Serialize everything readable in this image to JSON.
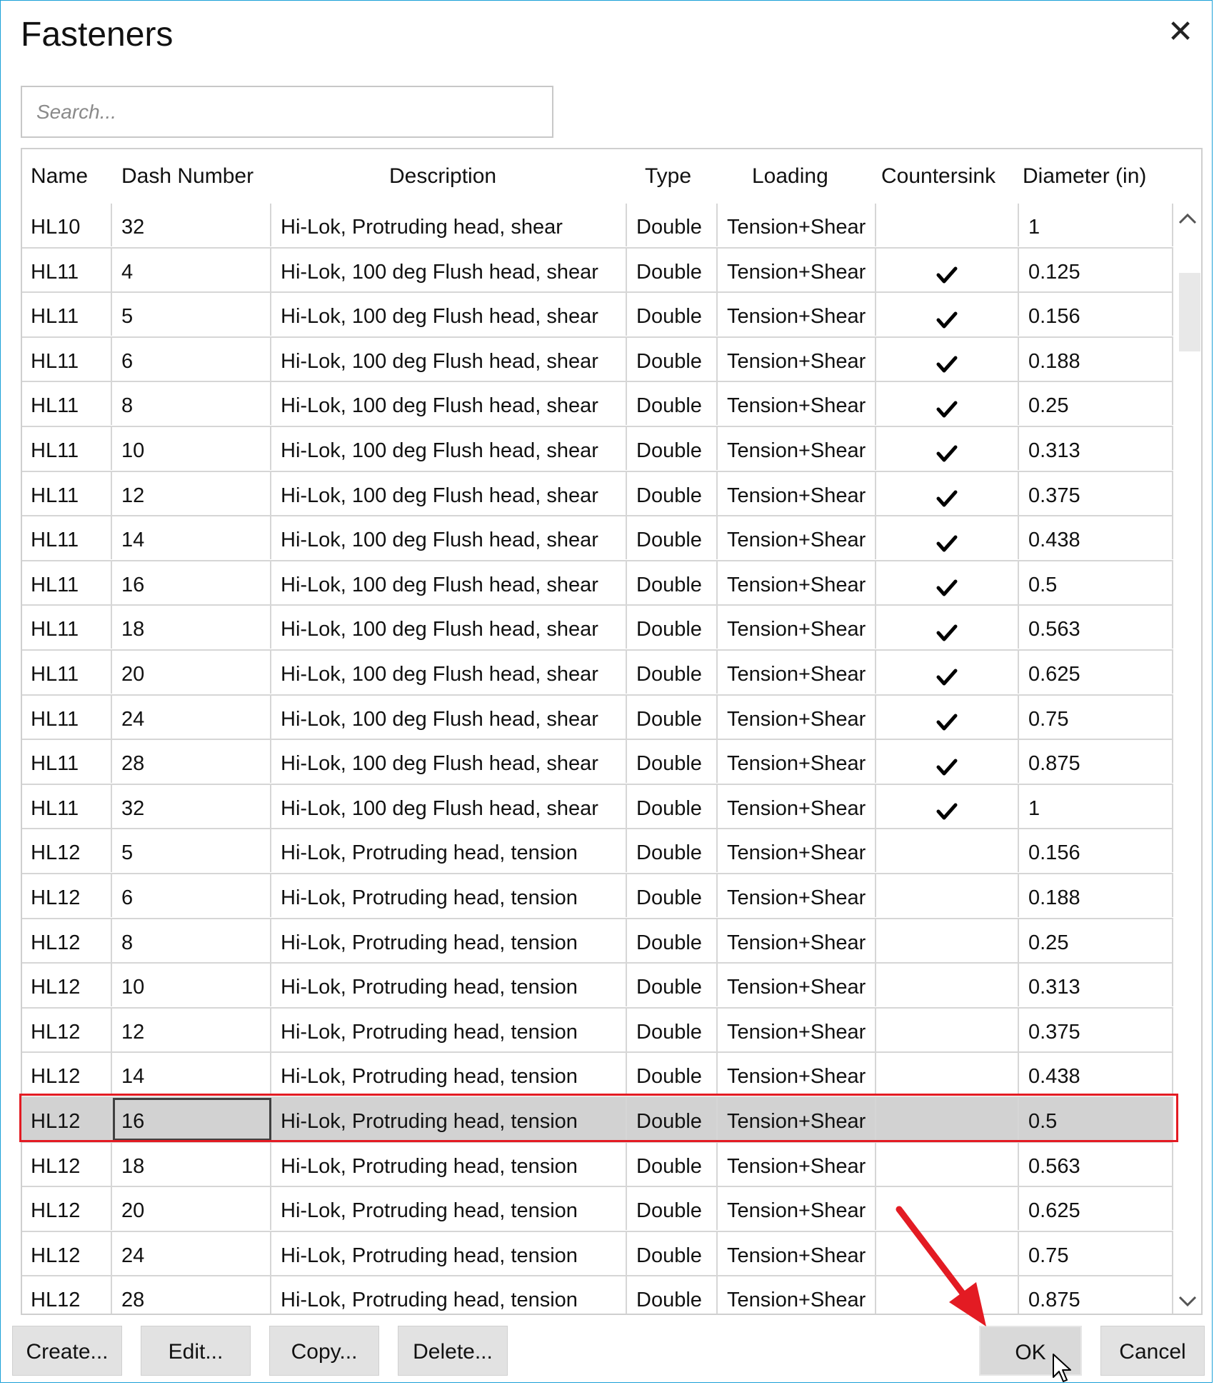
{
  "window": {
    "title": "Fasteners",
    "close_glyph": "✕"
  },
  "search": {
    "placeholder": "Search...",
    "value": ""
  },
  "columns": [
    "Name",
    "Dash Number",
    "Description",
    "Type",
    "Loading",
    "Countersink",
    "Diameter (in)"
  ],
  "rows": [
    {
      "name": "HL10",
      "dash": "32",
      "description": "Hi-Lok, Protruding head, shear",
      "type": "Double",
      "loading": "Tension+Shear",
      "countersink": false,
      "diameter": "1"
    },
    {
      "name": "HL11",
      "dash": "4",
      "description": "Hi-Lok, 100 deg Flush head, shear",
      "type": "Double",
      "loading": "Tension+Shear",
      "countersink": true,
      "diameter": "0.125"
    },
    {
      "name": "HL11",
      "dash": "5",
      "description": "Hi-Lok, 100 deg Flush head, shear",
      "type": "Double",
      "loading": "Tension+Shear",
      "countersink": true,
      "diameter": "0.156"
    },
    {
      "name": "HL11",
      "dash": "6",
      "description": "Hi-Lok, 100 deg Flush head, shear",
      "type": "Double",
      "loading": "Tension+Shear",
      "countersink": true,
      "diameter": "0.188"
    },
    {
      "name": "HL11",
      "dash": "8",
      "description": "Hi-Lok, 100 deg Flush head, shear",
      "type": "Double",
      "loading": "Tension+Shear",
      "countersink": true,
      "diameter": "0.25"
    },
    {
      "name": "HL11",
      "dash": "10",
      "description": "Hi-Lok, 100 deg Flush head, shear",
      "type": "Double",
      "loading": "Tension+Shear",
      "countersink": true,
      "diameter": "0.313"
    },
    {
      "name": "HL11",
      "dash": "12",
      "description": "Hi-Lok, 100 deg Flush head, shear",
      "type": "Double",
      "loading": "Tension+Shear",
      "countersink": true,
      "diameter": "0.375"
    },
    {
      "name": "HL11",
      "dash": "14",
      "description": "Hi-Lok, 100 deg Flush head, shear",
      "type": "Double",
      "loading": "Tension+Shear",
      "countersink": true,
      "diameter": "0.438"
    },
    {
      "name": "HL11",
      "dash": "16",
      "description": "Hi-Lok, 100 deg Flush head, shear",
      "type": "Double",
      "loading": "Tension+Shear",
      "countersink": true,
      "diameter": "0.5"
    },
    {
      "name": "HL11",
      "dash": "18",
      "description": "Hi-Lok, 100 deg Flush head, shear",
      "type": "Double",
      "loading": "Tension+Shear",
      "countersink": true,
      "diameter": "0.563"
    },
    {
      "name": "HL11",
      "dash": "20",
      "description": "Hi-Lok, 100 deg Flush head, shear",
      "type": "Double",
      "loading": "Tension+Shear",
      "countersink": true,
      "diameter": "0.625"
    },
    {
      "name": "HL11",
      "dash": "24",
      "description": "Hi-Lok, 100 deg Flush head, shear",
      "type": "Double",
      "loading": "Tension+Shear",
      "countersink": true,
      "diameter": "0.75"
    },
    {
      "name": "HL11",
      "dash": "28",
      "description": "Hi-Lok, 100 deg Flush head, shear",
      "type": "Double",
      "loading": "Tension+Shear",
      "countersink": true,
      "diameter": "0.875"
    },
    {
      "name": "HL11",
      "dash": "32",
      "description": "Hi-Lok, 100 deg Flush head, shear",
      "type": "Double",
      "loading": "Tension+Shear",
      "countersink": true,
      "diameter": "1"
    },
    {
      "name": "HL12",
      "dash": "5",
      "description": "Hi-Lok, Protruding head, tension",
      "type": "Double",
      "loading": "Tension+Shear",
      "countersink": false,
      "diameter": "0.156"
    },
    {
      "name": "HL12",
      "dash": "6",
      "description": "Hi-Lok, Protruding head, tension",
      "type": "Double",
      "loading": "Tension+Shear",
      "countersink": false,
      "diameter": "0.188"
    },
    {
      "name": "HL12",
      "dash": "8",
      "description": "Hi-Lok, Protruding head, tension",
      "type": "Double",
      "loading": "Tension+Shear",
      "countersink": false,
      "diameter": "0.25"
    },
    {
      "name": "HL12",
      "dash": "10",
      "description": "Hi-Lok, Protruding head, tension",
      "type": "Double",
      "loading": "Tension+Shear",
      "countersink": false,
      "diameter": "0.313"
    },
    {
      "name": "HL12",
      "dash": "12",
      "description": "Hi-Lok, Protruding head, tension",
      "type": "Double",
      "loading": "Tension+Shear",
      "countersink": false,
      "diameter": "0.375"
    },
    {
      "name": "HL12",
      "dash": "14",
      "description": "Hi-Lok, Protruding head, tension",
      "type": "Double",
      "loading": "Tension+Shear",
      "countersink": false,
      "diameter": "0.438"
    },
    {
      "name": "HL12",
      "dash": "16",
      "description": "Hi-Lok, Protruding head, tension",
      "type": "Double",
      "loading": "Tension+Shear",
      "countersink": false,
      "diameter": "0.5",
      "selected": true
    },
    {
      "name": "HL12",
      "dash": "18",
      "description": "Hi-Lok, Protruding head, tension",
      "type": "Double",
      "loading": "Tension+Shear",
      "countersink": false,
      "diameter": "0.563"
    },
    {
      "name": "HL12",
      "dash": "20",
      "description": "Hi-Lok, Protruding head, tension",
      "type": "Double",
      "loading": "Tension+Shear",
      "countersink": false,
      "diameter": "0.625"
    },
    {
      "name": "HL12",
      "dash": "24",
      "description": "Hi-Lok, Protruding head, tension",
      "type": "Double",
      "loading": "Tension+Shear",
      "countersink": false,
      "diameter": "0.75"
    },
    {
      "name": "HL12",
      "dash": "28",
      "description": "Hi-Lok, Protruding head, tension",
      "type": "Double",
      "loading": "Tension+Shear",
      "countersink": false,
      "diameter": "0.875"
    }
  ],
  "buttons": {
    "create": "Create...",
    "edit": "Edit...",
    "copy": "Copy...",
    "delete": "Delete...",
    "ok": "OK",
    "cancel": "Cancel"
  },
  "colors": {
    "selection_row": "#d2d2d2",
    "highlight_outline": "#e31b23",
    "annotation_arrow": "#e31b23",
    "window_border": "#1aa0d8"
  },
  "icons": {
    "close": "close-icon",
    "checkmark": "checkmark-icon",
    "scroll_up": "chevron-up-icon",
    "scroll_down": "chevron-down-icon",
    "cursor": "mouse-pointer-icon",
    "annotation": "red-arrow-icon"
  }
}
